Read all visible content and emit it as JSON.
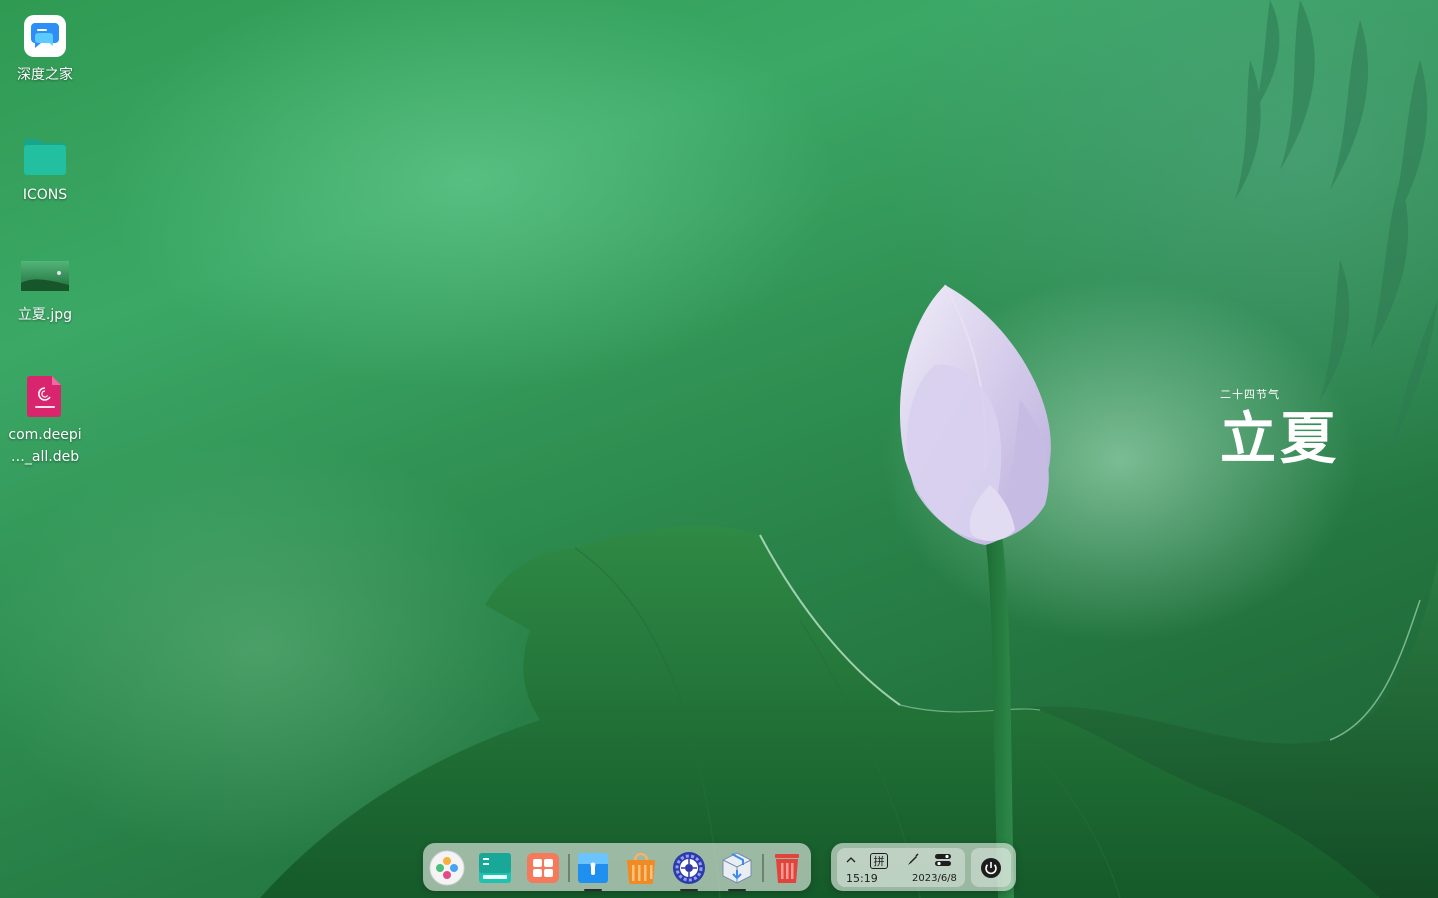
{
  "desktop": {
    "icons": [
      {
        "label": "深度之家",
        "icon": "deepin-home-icon"
      },
      {
        "label": "ICONS",
        "icon": "folder-icon"
      },
      {
        "label": "立夏.jpg",
        "icon": "image-thumbnail-icon"
      },
      {
        "label_line1": "com.deepi",
        "label_line2": "…_all.deb",
        "icon": "debian-package-icon"
      }
    ]
  },
  "wallpaper": {
    "caption_small": "二十四节气",
    "caption_big": "立夏"
  },
  "dock": {
    "apps": [
      {
        "name": "launcher",
        "icon": "launcher-icon",
        "running": false
      },
      {
        "name": "terminal",
        "icon": "terminal-icon",
        "running": false
      },
      {
        "name": "multitasking",
        "icon": "multitask-view-icon",
        "running": false
      },
      {
        "name": "file-manager",
        "icon": "file-manager-icon",
        "running": true
      },
      {
        "name": "app-store",
        "icon": "app-store-icon",
        "running": false
      },
      {
        "name": "control-center",
        "icon": "settings-gear-icon",
        "running": true
      },
      {
        "name": "package-installer",
        "icon": "package-installer-icon",
        "running": true
      },
      {
        "name": "trash",
        "icon": "trash-icon",
        "running": false
      }
    ]
  },
  "tray": {
    "expand_icon": "chevron-up-icon",
    "input_method": "拼",
    "edit_icon": "pen-icon",
    "toggle_icon": "control-toggle-icon",
    "time": "15:19",
    "date": "2023/6/8",
    "power_icon": "power-icon"
  },
  "colors": {
    "wallpaper_green": "#2f9a52",
    "lotus_petal": "#d9d2ee",
    "trash_red": "#e0443c",
    "store_orange": "#f08a24"
  }
}
